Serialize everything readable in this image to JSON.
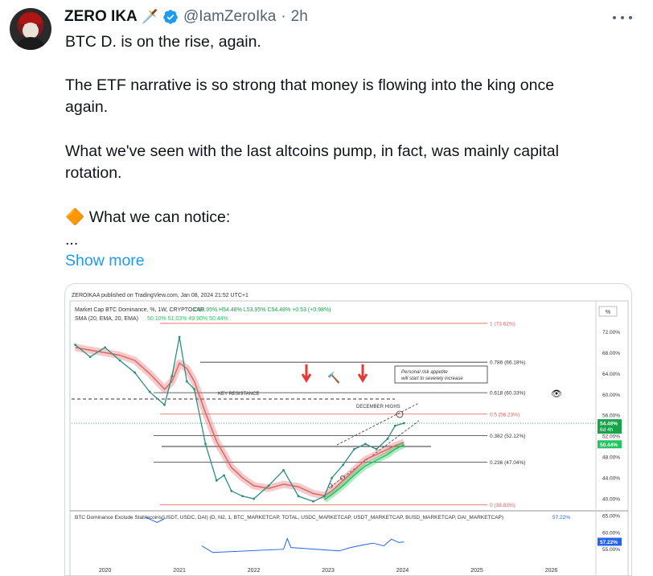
{
  "author": {
    "name": "ZERO IKA",
    "emoji": "🗡️",
    "handle": "@IamZeroIka",
    "separator": "·",
    "time": "2h"
  },
  "tweet": {
    "lines": [
      "BTC D. is on the rise, again.",
      "The ETF narrative is so strong that money is flowing into the king once",
      "again.",
      "What we've seen with the last altcoins pump, in fact, was mainly capital",
      "rotation.",
      "🔶 What we can notice:",
      "..."
    ],
    "show_more": "Show more"
  },
  "chart_data": {
    "type": "line",
    "header": "ZEROIKAA published on TradingView.com, Jan 08, 2024 21:52 UTC+1",
    "title": "Market Cap BTC Dominance, %, 1W, CRYPTOCAP",
    "ohlc": "O53.95% H54.48% L53.95% C54.48% +0.53 (+0.98%)",
    "ma_label": "SMA (20, EMA, 20, EMA)",
    "ma_values": "50.10% 51.03% 49.90% 50.44%",
    "pct_button": "%",
    "x_ticks": [
      "2020",
      "2021",
      "2022",
      "2023",
      "2024",
      "2025",
      "2026"
    ],
    "y_ticks": [
      "72.00%",
      "68.00%",
      "64.00%",
      "60.00%",
      "56.00%",
      "52.00%",
      "48.00%",
      "44.00%",
      "40.00%"
    ],
    "y_range": [
      38,
      75
    ],
    "fib_levels": [
      {
        "label": "1 (73.62%)",
        "value": 73.62,
        "color": "#e85c5c"
      },
      {
        "label": "0.786 (66.18%)",
        "value": 66.18,
        "color": "#333333"
      },
      {
        "label": "0.618 (60.33%)",
        "value": 60.33,
        "color": "#333333"
      },
      {
        "label": "0.5 (56.23%)",
        "value": 56.23,
        "color": "#e85c5c"
      },
      {
        "label": "0.382 (52.12%)",
        "value": 52.12,
        "color": "#333333"
      },
      {
        "label": "0.236 (47.04%)",
        "value": 47.04,
        "color": "#333333"
      },
      {
        "label": "0 (38.83%)",
        "value": 38.83,
        "color": "#e85c5c"
      }
    ],
    "price_tags": [
      {
        "label": "54.48%",
        "sub": "6d 4h",
        "value": 54.48,
        "color": "#16a34a"
      },
      {
        "label": "50.44%",
        "value": 50.44,
        "color": "#22c55e"
      }
    ],
    "annotations": {
      "key_resistance": "KEY RESISTANCE",
      "december_highs": "DECEMBER HIGHS",
      "note": [
        "Personal risk appetite",
        "will start to severely increase"
      ],
      "hammer": "🔨",
      "eye": "👁"
    },
    "x": [
      2019.6,
      2019.8,
      2020.0,
      2020.2,
      2020.4,
      2020.6,
      2020.8,
      2020.9,
      2021.0,
      2021.1,
      2021.2,
      2021.35,
      2021.5,
      2021.6,
      2021.7,
      2021.85,
      2022.0,
      2022.2,
      2022.4,
      2022.6,
      2022.8,
      2022.95,
      2023.05,
      2023.2,
      2023.35,
      2023.5,
      2023.65,
      2023.8,
      2023.9,
      2024.02
    ],
    "series": [
      {
        "name": "BTC Dominance",
        "color": "#2a8f7c",
        "values": [
          69.5,
          67.2,
          69.0,
          66.5,
          64.2,
          60.5,
          58.0,
          63.5,
          71.0,
          62.5,
          61.0,
          50.5,
          43.5,
          44.5,
          41.5,
          40.5,
          40.0,
          42.5,
          45.5,
          40.5,
          39.5,
          40.5,
          44.0,
          46.5,
          49.5,
          50.5,
          49.5,
          51.5,
          54.0,
          54.5
        ]
      },
      {
        "name": "EMA 20",
        "color": "#e06666",
        "values": [
          69.0,
          68.5,
          68.0,
          67.5,
          66.5,
          64.0,
          61.0,
          62.5,
          66.0,
          65.0,
          62.5,
          56.5,
          51.0,
          48.5,
          46.0,
          44.0,
          42.5,
          42.0,
          42.8,
          42.3,
          41.0,
          40.6,
          41.5,
          43.5,
          45.5,
          47.5,
          48.5,
          49.5,
          50.2,
          50.8
        ]
      },
      {
        "name": "EMA 20 low",
        "color": "#22c55e",
        "values": [
          null,
          null,
          null,
          null,
          null,
          null,
          null,
          null,
          null,
          null,
          null,
          null,
          null,
          null,
          null,
          null,
          null,
          null,
          null,
          null,
          null,
          39.8,
          40.8,
          42.5,
          44.5,
          46.3,
          47.4,
          48.5,
          49.5,
          50.4
        ]
      }
    ],
    "sub_chart": {
      "label": "BTC Dominance Exclude Stablecoins(USDT, USDC, DAI) (D, hl2, 1, BTC_MARKETCAP, TOTAL, USDC_MARKETCAP, USDT_MARKETCAP, BUSD_MARKETCAP, DAI_MARKETCAP)",
      "value_label": "57.22%",
      "y_ticks": [
        "65.00%",
        "60.00%",
        "55.00%"
      ],
      "y_range": [
        53,
        66
      ],
      "x": [
        2020.55,
        2020.7,
        2020.8,
        2021.1,
        2021.3,
        2021.45,
        2022.4,
        2022.45,
        2022.5,
        2023.15,
        2023.3,
        2023.45,
        2023.6,
        2023.75,
        2023.85,
        2023.95,
        2024.02
      ],
      "values": [
        64.5,
        63.0,
        64.2,
        null,
        56.0,
        54.0,
        55.0,
        58.2,
        55.5,
        54.5,
        55.5,
        56.2,
        56.8,
        56.0,
        58.0,
        57.0,
        57.2
      ]
    }
  }
}
